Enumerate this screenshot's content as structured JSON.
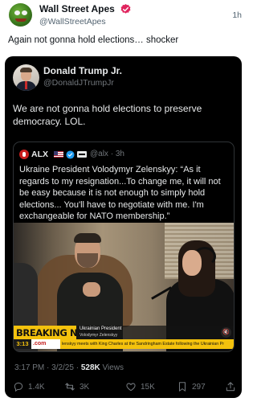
{
  "outer_post": {
    "author_name": "Wall Street Apes",
    "author_handle": "@WallStreetApes",
    "time": "1h",
    "text": "Again not gonna hold elections… shocker",
    "avatar_icon": "frog-avatar",
    "verified_color": "#e0245e"
  },
  "embedded_post": {
    "author_name": "Donald Trump Jr.",
    "author_handle": "@DonaldJTrumpJr",
    "text_lines": [
      "We are not gonna hold elections to preserve",
      "democracy. LOL."
    ],
    "timestamp": "3:17 PM · 3/2/25 · ",
    "views_count": "528K",
    "views_label": " Views",
    "replies": "1.4K",
    "reposts": "3K",
    "likes": "15K",
    "bookmarks": "297",
    "background": "#000000"
  },
  "quoted_post": {
    "author_name": "ALX",
    "author_handle": "@alx · 3h",
    "text_lines": [
      "Ukraine President Volodymyr Zelenskyy: “As it",
      "regards to my resignation...To change me, it will not",
      "be easy because it is not enough to simply hold",
      "elections... You'll have to negotiate with me. I'm",
      "exchangeable for NATO membership.”"
    ]
  },
  "video": {
    "breaking_label": "BREAKING NEWS",
    "lower_third_title": "Ukrainian President",
    "lower_third_subtitle": "Volodymyr Zelenskyy",
    "timecode": "3:13",
    "source_tag": ".com",
    "ticker_text": "lenskyy meets with King Charles at the Sandringham Estate following the Ukrainian Pr",
    "accent_color": "#f4c20d"
  }
}
